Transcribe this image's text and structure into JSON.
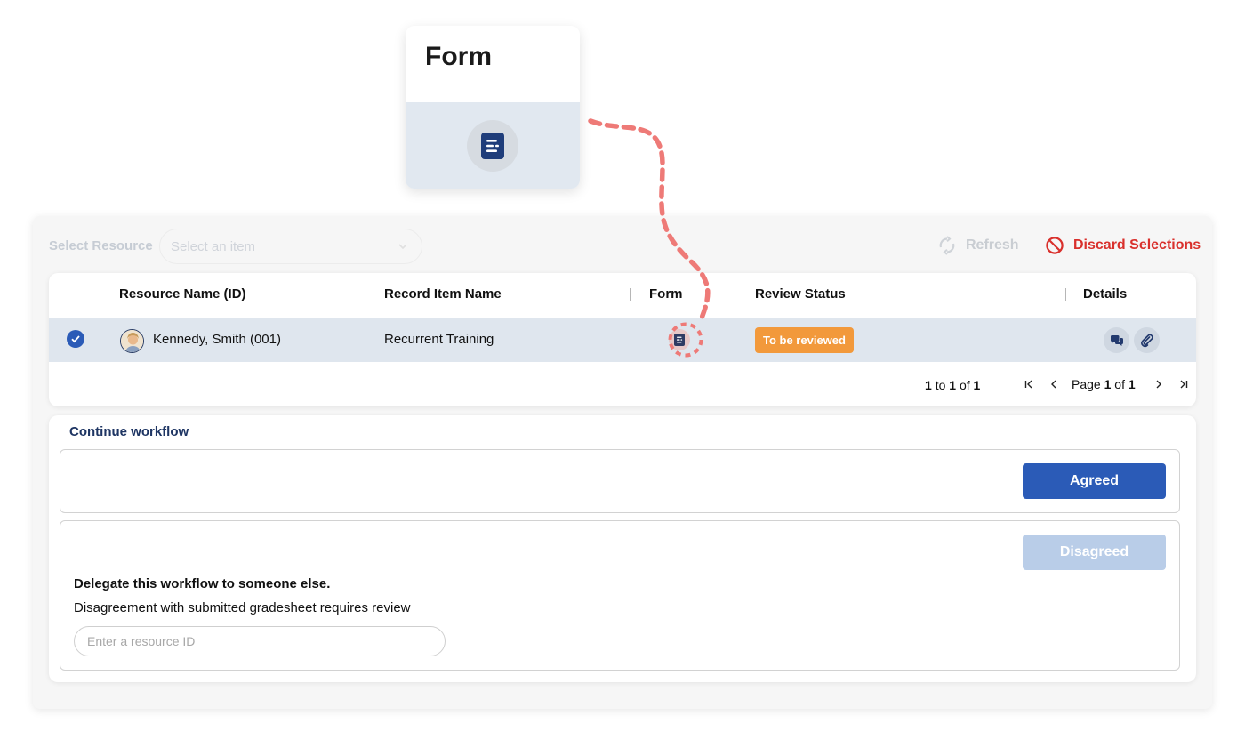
{
  "callout": {
    "title": "Form",
    "icon": "form-document-icon"
  },
  "toolbar": {
    "select_label": "Select Resource",
    "select_placeholder": "Select an item",
    "refresh_label": "Refresh",
    "discard_label": "Discard Selections"
  },
  "table": {
    "columns": [
      "Resource Name (ID)",
      "Record Item Name",
      "Form",
      "Review Status",
      "Details"
    ],
    "rows": [
      {
        "selected": true,
        "resource_name": "Kennedy, Smith (001)",
        "record_item": "Recurrent Training",
        "status": "To be reviewed"
      }
    ],
    "footer": {
      "count_from": "1",
      "count_to_word": "to",
      "count_to": "1",
      "count_of_word": "of",
      "count_total": "1",
      "page_word": "Page",
      "page_current": "1",
      "page_of_word": "of",
      "page_total": "1"
    }
  },
  "workflow": {
    "title": "Continue workflow",
    "agree_label": "Agreed",
    "disagree_label": "Disagreed",
    "delegate_title": "Delegate this workflow to someone else.",
    "delegate_subtitle": "Disagreement with submitted gradesheet requires review",
    "resource_placeholder": "Enter a resource ID"
  },
  "colors": {
    "primary": "#2b5bb7",
    "danger": "#d9302c",
    "status_badge": "#f2993b",
    "connector": "#ee7a77",
    "row_highlight": "#dfe6ee"
  }
}
